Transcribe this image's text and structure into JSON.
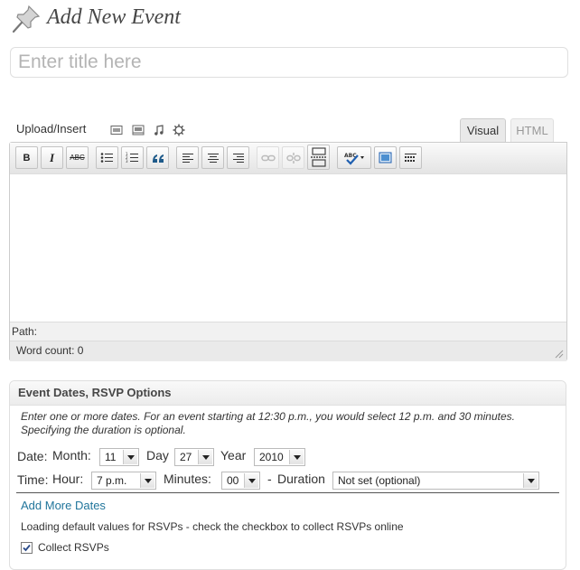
{
  "page": {
    "title": "Add New Event"
  },
  "title_input": {
    "placeholder": "Enter title here",
    "value": ""
  },
  "upload": {
    "label": "Upload/Insert"
  },
  "tabs": {
    "visual": "Visual",
    "html": "HTML"
  },
  "toolbar": {
    "bold": "B",
    "italic": "I",
    "strike": "ABC",
    "spell": "ABC"
  },
  "editor": {
    "path_label": "Path:",
    "word_count": "Word count: 0"
  },
  "event_box": {
    "title": "Event Dates, RSVP Options",
    "intro": "Enter one or more dates. For an event starting at 12:30 p.m., you would select 12 p.m. and 30 minutes. Specifying the duration is optional.",
    "date_label": "Date:",
    "month_label": "Month:",
    "month_value": "11",
    "day_label": "Day",
    "day_value": "27",
    "year_label": "Year",
    "year_value": "2010",
    "time_label": "Time:",
    "hour_label": "Hour:",
    "hour_value": "7 p.m.",
    "minutes_label": "Minutes:",
    "minutes_value": "00",
    "dash": "-",
    "duration_label": "Duration",
    "duration_value": "Not set (optional)",
    "add_more": "Add More Dates",
    "rsvp_note": "Loading default values for RSVPs - check the checkbox to collect RSVPs online",
    "collect_label": "Collect RSVPs",
    "collect_checked": true
  },
  "colors": {
    "link": "#21759b",
    "title": "#464646",
    "border": "#dfdfdf"
  }
}
